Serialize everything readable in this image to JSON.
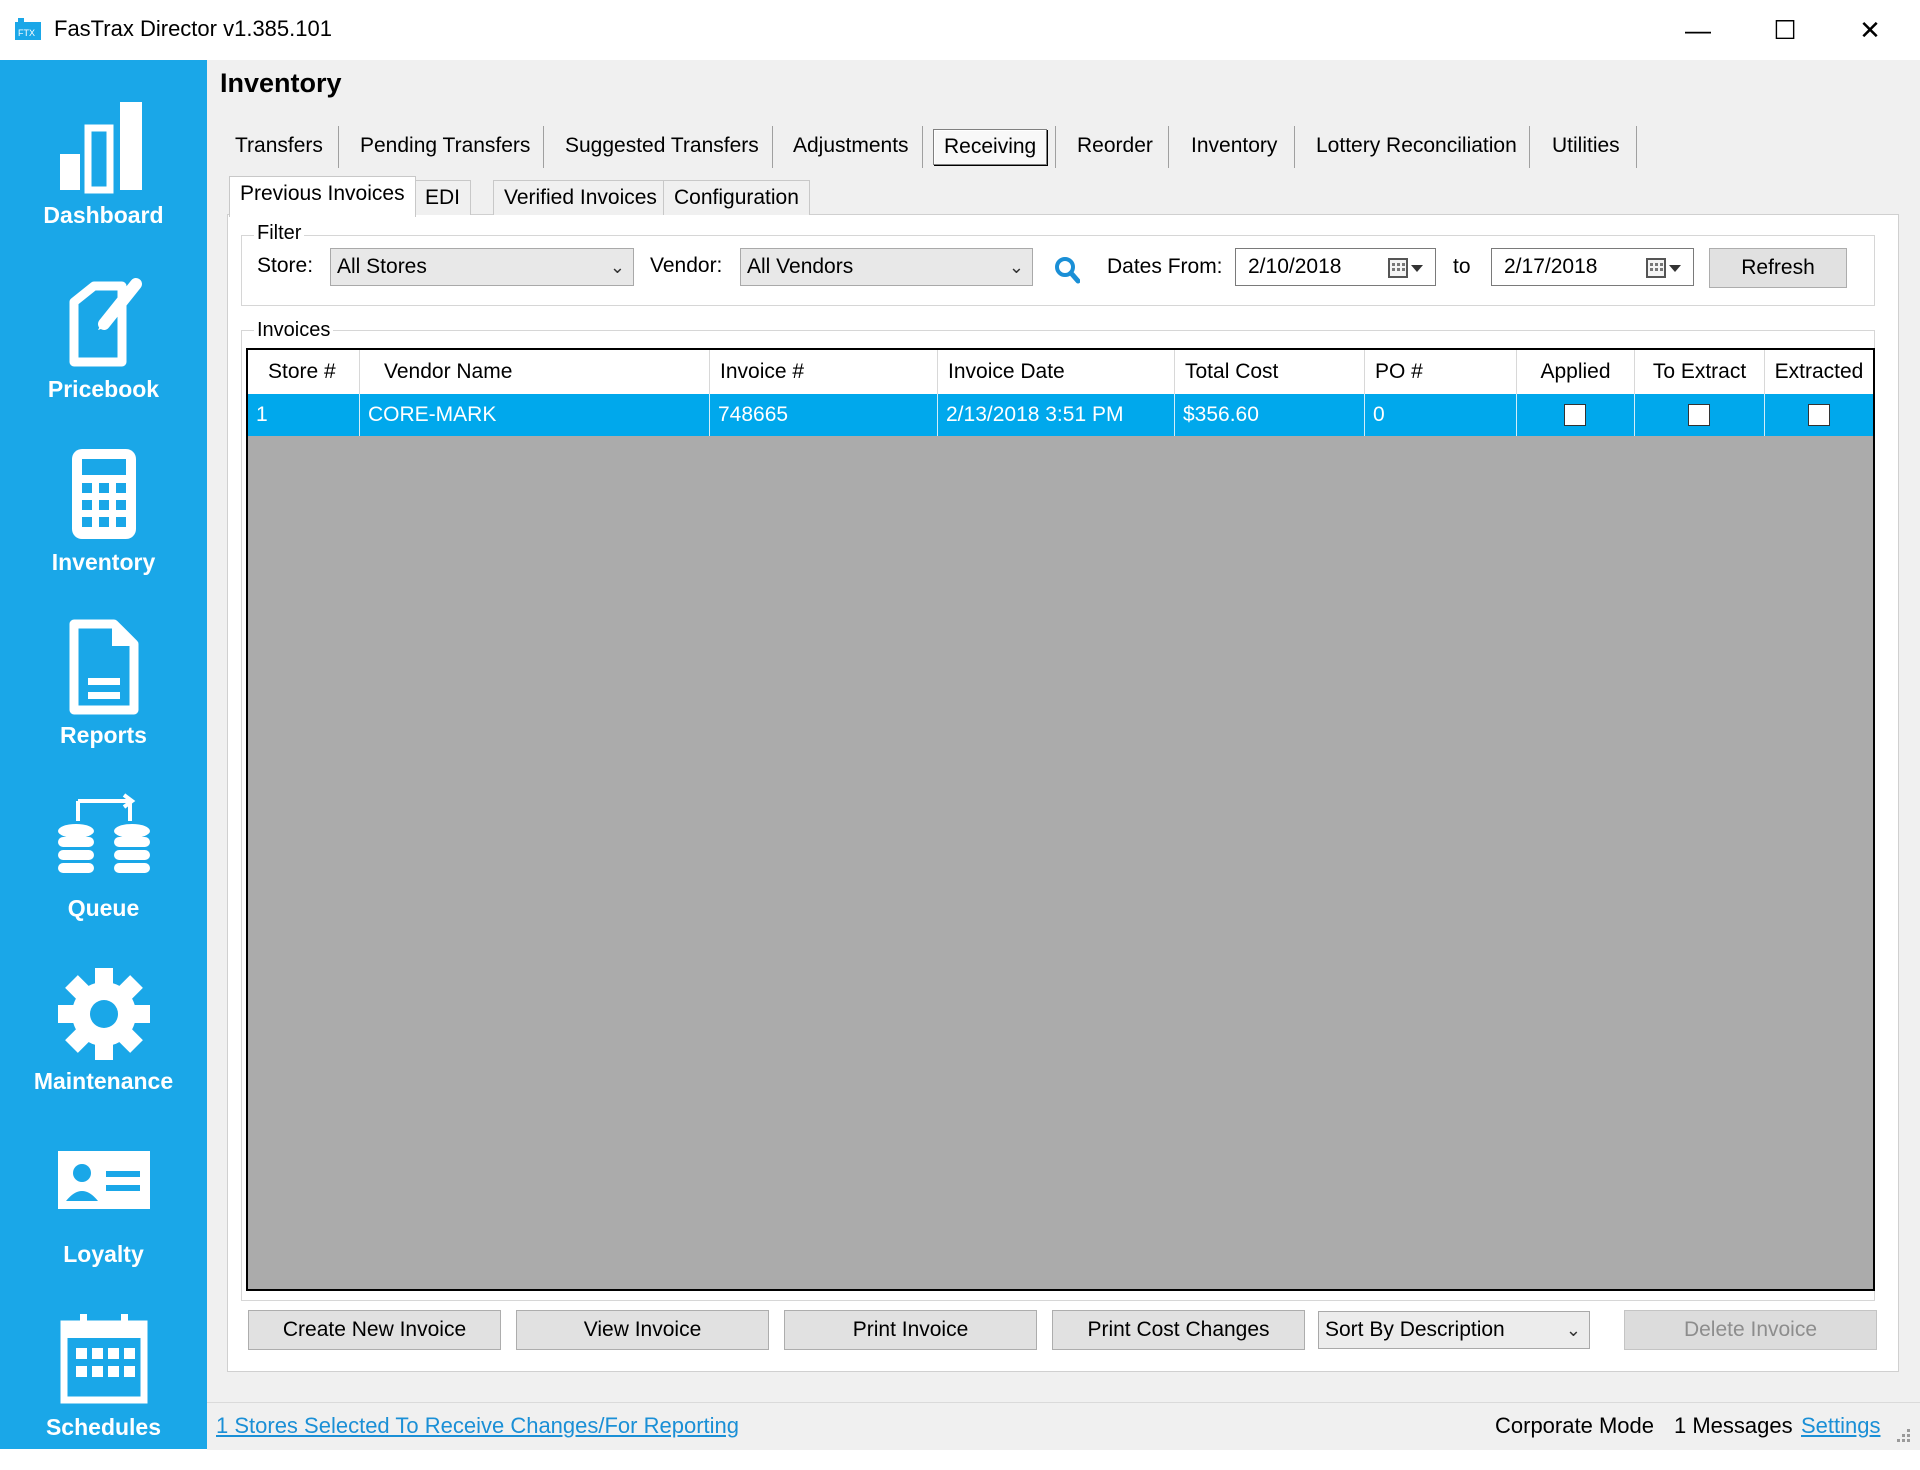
{
  "window": {
    "title": "FasTrax Director v1.385.101",
    "controls": {
      "minimize": "—",
      "maximize": "☐",
      "close": "✕"
    }
  },
  "sidebar": {
    "items": [
      {
        "label": "Dashboard",
        "icon": "bar-chart-icon"
      },
      {
        "label": "Pricebook",
        "icon": "pricebook-icon"
      },
      {
        "label": "Inventory",
        "icon": "calculator-icon"
      },
      {
        "label": "Reports",
        "icon": "document-icon"
      },
      {
        "label": "Queue",
        "icon": "database-transfer-icon"
      },
      {
        "label": "Maintenance",
        "icon": "gear-icon"
      },
      {
        "label": "Loyalty",
        "icon": "id-card-icon"
      },
      {
        "label": "Schedules",
        "icon": "calendar-icon"
      }
    ],
    "bg": "#1aa7e8"
  },
  "page": {
    "title": "Inventory"
  },
  "top_tabs": [
    "Transfers",
    "Pending Transfers",
    "Suggested Transfers",
    "Adjustments",
    "Receiving",
    "Reorder",
    "Inventory",
    "Lottery Reconciliation",
    "Utilities"
  ],
  "active_top_tab": "Receiving",
  "sub_tabs": [
    "Previous Invoices",
    "EDI",
    "Verified Invoices",
    "Configuration"
  ],
  "active_sub_tab": "Previous Invoices",
  "filter": {
    "legend": "Filter",
    "store_label": "Store:",
    "store_value": "All Stores",
    "vendor_label": "Vendor:",
    "vendor_value": "All Vendors",
    "dates_from_label": "Dates From:",
    "date_from": "2/10/2018",
    "to_label": "to",
    "date_to": "2/17/2018",
    "refresh_label": "Refresh"
  },
  "invoices": {
    "legend": "Invoices",
    "columns": [
      "Store #",
      "Vendor Name",
      "Invoice #",
      "Invoice Date",
      "Total Cost",
      "PO #",
      "Applied",
      "To Extract",
      "Extracted"
    ],
    "rows": [
      {
        "store": "1",
        "vendor": "CORE-MARK",
        "invoice": "748665",
        "date": "2/13/2018 3:51 PM",
        "total": "$356.60",
        "po": "0",
        "applied": false,
        "to_extract": false,
        "extracted": false
      }
    ],
    "selected_row_color": "#00a8ec"
  },
  "actions": {
    "create": "Create New Invoice",
    "view": "View Invoice",
    "print": "Print Invoice",
    "print_cost": "Print Cost Changes",
    "sort_value": "Sort By Description",
    "delete": "Delete Invoice"
  },
  "status": {
    "stores_link": "1 Stores Selected To Receive Changes/For Reporting",
    "mode": "Corporate Mode",
    "messages": "1 Messages",
    "settings": "Settings"
  }
}
